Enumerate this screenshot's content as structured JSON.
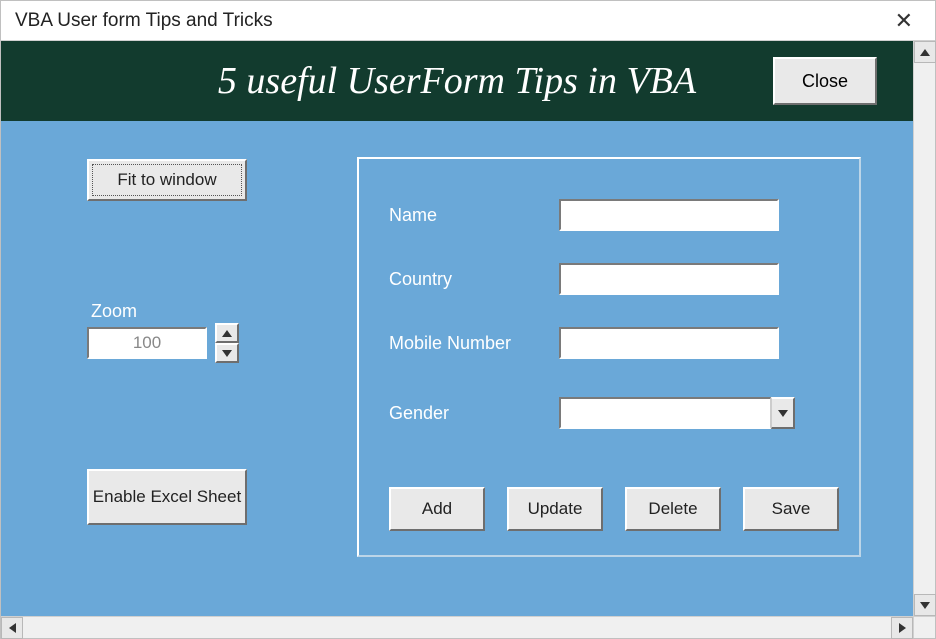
{
  "window": {
    "title": "VBA User form Tips and Tricks"
  },
  "header": {
    "title": "5 useful UserForm Tips in VBA",
    "close_label": "Close"
  },
  "left_panel": {
    "fit_label": "Fit to window",
    "zoom_label": "Zoom",
    "zoom_value": "100",
    "enable_label": "Enable Excel Sheet"
  },
  "form": {
    "fields": {
      "name_label": "Name",
      "country_label": "Country",
      "mobile_label": "Mobile Number",
      "gender_label": "Gender"
    },
    "buttons": {
      "add": "Add",
      "update": "Update",
      "delete": "Delete",
      "save": "Save"
    }
  }
}
